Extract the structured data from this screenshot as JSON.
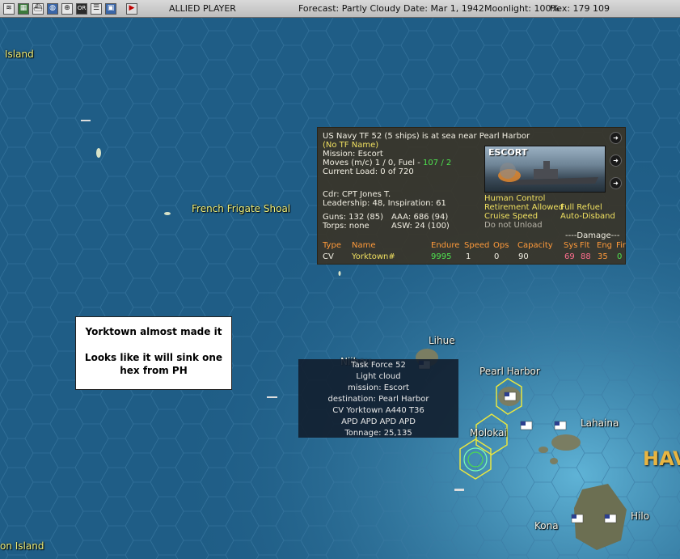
{
  "toolbar": {
    "player": "ALLIED PLAYER",
    "forecast": "Forecast: Partly Cloudy",
    "date": "Date: Mar 1, 1942",
    "moonlight": "Moonlight: 100%",
    "hex": "Hex: 179 109",
    "buttons": [
      "overview-icon",
      "map-icon",
      "ship-icon",
      "globe-icon",
      "target-icon",
      "or-report-icon",
      "list-icon",
      "intel-icon",
      "end-turn-icon"
    ],
    "or_label": "OR"
  },
  "map": {
    "labels": {
      "island_nw": "Island",
      "french_frigate": "French Frigate Shoal",
      "lihue": "Lihue",
      "pearl_harbor": "Pearl Harbor",
      "niihau": "Niihau",
      "molokai": "Molokai",
      "lahaina": "Lahaina",
      "hilo": "Hilo",
      "kona": "Kona",
      "johnston": "on Island",
      "hawaii": "HAV"
    }
  },
  "tf_panel": {
    "header": "US Navy TF 52 (5 ships) is at sea near Pearl Harbor",
    "tf_name": "(No TF Name)",
    "mission": "Mission: Escort",
    "moves_prefix": "Moves (m/c) 1 / 0, Fuel - ",
    "fuel": "107 / 2",
    "load": "Current Load: 0 of 720",
    "cdr": "Cdr: CPT Jones T.",
    "leadership": "Leadership: 48, Inspiration: 61",
    "guns": "Guns: 132 (85)",
    "aaa": "AAA: 686 (94)",
    "torps": "Torps: none",
    "asw": "ASW: 24 (100)",
    "escort_label": "ESCORT",
    "opt_human": "Human Control",
    "opt_retire": "Retirement Allowed",
    "opt_cruise": "Cruise Speed",
    "opt_unload": "Do not Unload",
    "opt_refuel": "Full Refuel",
    "opt_disband": "Auto-Disband",
    "damage_header": "----Damage---",
    "columns": [
      "Type",
      "Name",
      "Endure",
      "Speed",
      "Ops",
      "Capacity",
      "Sys",
      "Flt",
      "Eng",
      "Fir"
    ],
    "row": {
      "type": "CV",
      "name": "Yorktown#",
      "endure": "9995",
      "speed": "1",
      "ops": "0",
      "capacity": "90",
      "sys": "69",
      "flt": "88",
      "eng": "35",
      "fir": "0"
    }
  },
  "note": {
    "line1": "Yorktown almost made it",
    "line2": "Looks like it will sink one",
    "line3": "hex from PH"
  },
  "tooltip": {
    "l1": "Task Force 52",
    "l2": "Light cloud",
    "l3": "mission: Escort",
    "l4": "destination: Pearl Harbor",
    "l5": "CV Yorktown A440  T36",
    "l6": "APD APD APD APD",
    "l7": "Tonnage: 25,135"
  }
}
